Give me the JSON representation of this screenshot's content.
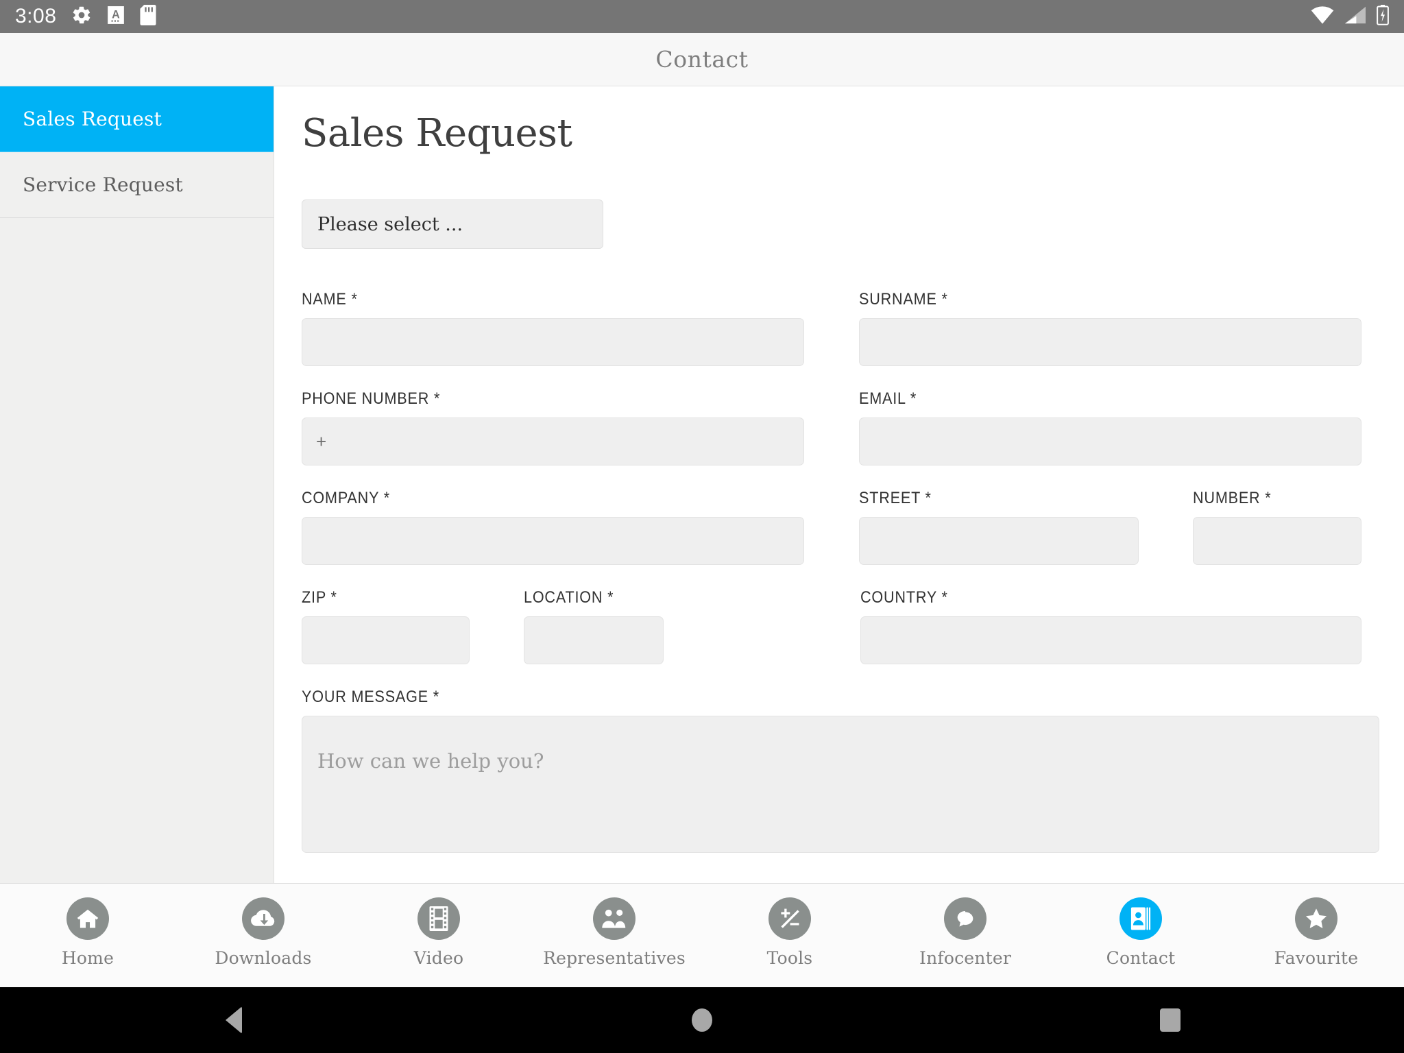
{
  "status_bar": {
    "clock": "3:08",
    "icons_left": [
      "gear-icon",
      "font-a-icon",
      "sd-card-icon"
    ],
    "icons_right": [
      "wifi-icon",
      "cell-signal-icon",
      "battery-charging-icon"
    ],
    "background": "#757575"
  },
  "appbar": {
    "title": "Contact"
  },
  "sidebar": {
    "items": [
      {
        "label": "Sales Request",
        "active": true
      },
      {
        "label": "Service Request",
        "active": false
      }
    ],
    "active_color": "#00b2f5"
  },
  "main": {
    "page_title": "Sales Request",
    "select": {
      "value": "Please select ..."
    },
    "fields": {
      "name": {
        "label": "NAME *",
        "value": "",
        "placeholder": ""
      },
      "surname": {
        "label": "SURNAME *",
        "value": "",
        "placeholder": ""
      },
      "phone": {
        "label": "PHONE NUMBER *",
        "value": "+",
        "placeholder": "+"
      },
      "email": {
        "label": "EMAIL *",
        "value": "",
        "placeholder": ""
      },
      "company": {
        "label": "COMPANY *",
        "value": "",
        "placeholder": ""
      },
      "street": {
        "label": "STREET *",
        "value": "",
        "placeholder": ""
      },
      "number": {
        "label": "NUMBER *",
        "value": "",
        "placeholder": ""
      },
      "zip": {
        "label": "ZIP *",
        "value": "",
        "placeholder": ""
      },
      "location": {
        "label": "LOCATION *",
        "value": "",
        "placeholder": ""
      },
      "country": {
        "label": "COUNTRY *",
        "value": "",
        "placeholder": ""
      },
      "message": {
        "label": "YOUR MESSAGE *",
        "value": "",
        "placeholder": "How can we help you?"
      }
    }
  },
  "tabbar": {
    "items": [
      {
        "label": "Home",
        "icon": "house-icon",
        "active": false
      },
      {
        "label": "Downloads",
        "icon": "cloud-download-icon",
        "active": false
      },
      {
        "label": "Video",
        "icon": "film-strip-icon",
        "active": false
      },
      {
        "label": "Representatives",
        "icon": "people-group-icon",
        "active": false
      },
      {
        "label": "Tools",
        "icon": "plus-minus-icon",
        "active": false
      },
      {
        "label": "Infocenter",
        "icon": "speech-bubble-icon",
        "active": false
      },
      {
        "label": "Contact",
        "icon": "contact-book-icon",
        "active": true
      },
      {
        "label": "Favourite",
        "icon": "star-icon",
        "active": false
      }
    ],
    "active_color": "#00b2f5",
    "inactive_color": "#8a8f8d"
  },
  "navbar": {
    "buttons": [
      "back-triangle-icon",
      "home-circle-icon",
      "recents-square-icon"
    ]
  }
}
